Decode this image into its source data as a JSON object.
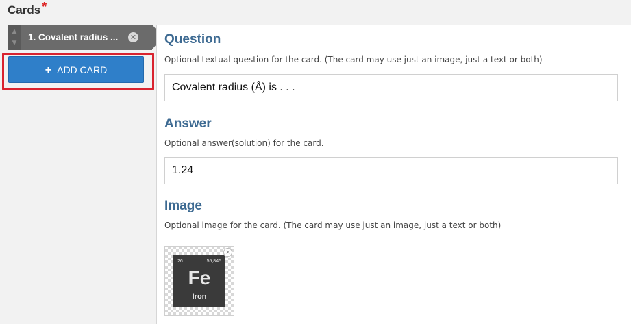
{
  "field": {
    "label": "Cards",
    "required_mark": "*"
  },
  "cards": {
    "items": [
      {
        "title": "1. Covalent radius ...",
        "remove_symbol": "✕"
      }
    ],
    "order_up": "▲",
    "order_down": "▼",
    "add_button_label": "ADD CARD",
    "add_button_icon": "+"
  },
  "editor": {
    "question": {
      "title": "Question",
      "description": "Optional textual question for the card. (The card may use just an image, just a text or both)",
      "value": "Covalent radius (Å) is . . ."
    },
    "answer": {
      "title": "Answer",
      "description": "Optional answer(solution) for the card.",
      "value": "1.24"
    },
    "image": {
      "title": "Image",
      "description": "Optional image for the card. (The card may use just an image, just a text or both)",
      "element": {
        "number": "26",
        "mass": "55,845",
        "symbol": "Fe",
        "name": "Iron"
      },
      "remove_symbol": "✕"
    }
  },
  "colors": {
    "accent": "#3d6a92",
    "button": "#2f7fc9",
    "highlight": "#d9232f",
    "tab": "#6b6b6b"
  }
}
